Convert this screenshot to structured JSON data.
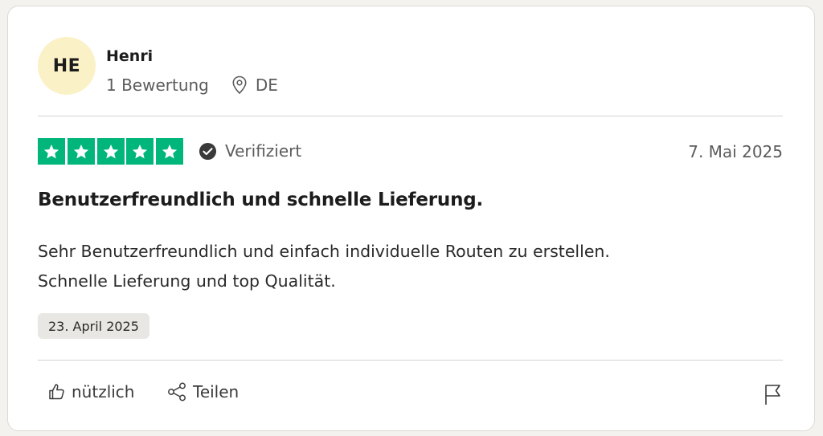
{
  "reviewer": {
    "initials": "HE",
    "name": "Henri",
    "review_count": "1 Bewertung",
    "country": "DE"
  },
  "rating": {
    "stars": 5,
    "max_stars": 5,
    "star_color": "#00b67a",
    "verified_label": "Verifiziert",
    "date": "7. Mai 2025"
  },
  "review": {
    "title": "Benutzerfreundlich und schnelle Lieferung.",
    "body_line1": "Sehr Benutzerfreundlich und einfach individuelle Routen zu erstellen.",
    "body_line2": "Schnelle Lieferung und top Qualität.",
    "experience_date": "23. April 2025"
  },
  "actions": {
    "useful_label": "nützlich",
    "share_label": "Teilen"
  },
  "icons": [
    "location-icon",
    "verified-check-icon",
    "star-icon",
    "thumbs-up-icon",
    "share-icon",
    "flag-icon"
  ]
}
